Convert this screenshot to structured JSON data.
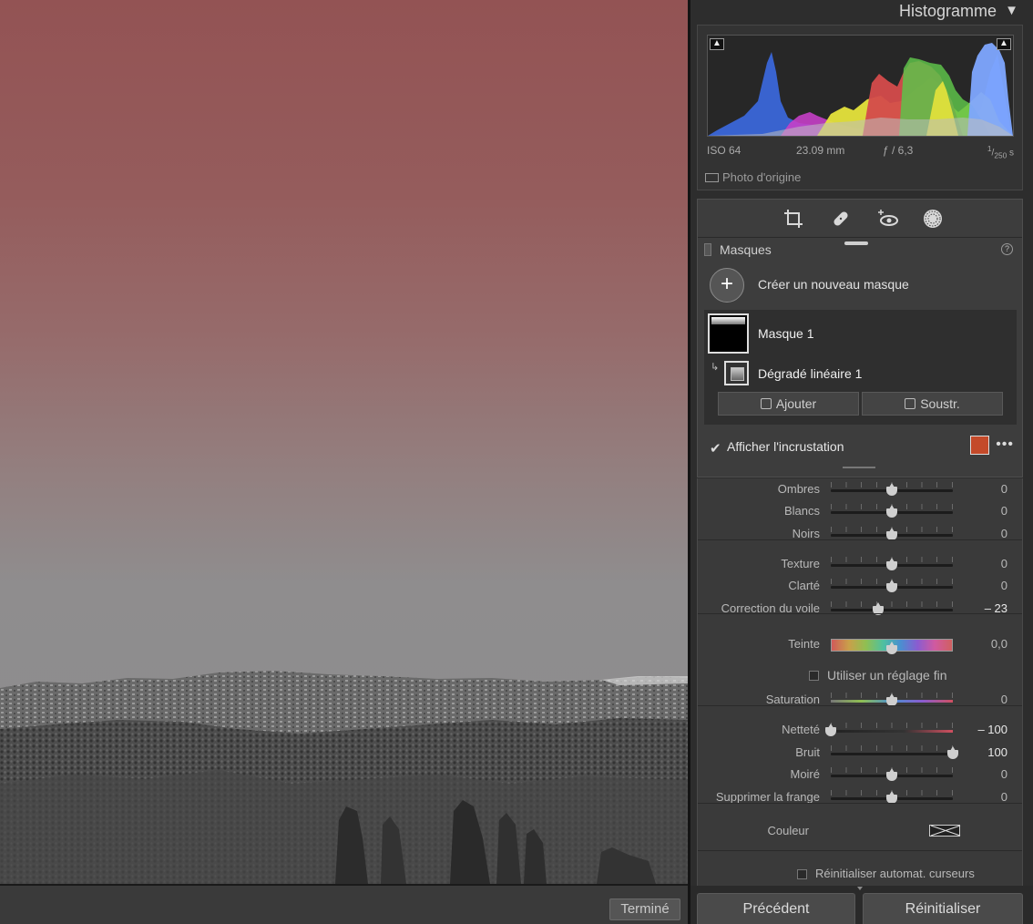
{
  "photo": {
    "done_label": "Terminé"
  },
  "histogram": {
    "title": "Histogramme",
    "iso": "ISO 64",
    "focal": "23.09 mm",
    "aperture": "ƒ / 6,3",
    "shutter_num": "1",
    "shutter_den": "250",
    "shutter_unit": "s",
    "original_label": "Photo d'origine"
  },
  "masks": {
    "header": "Masques",
    "new_mask_label": "Créer un nouveau masque",
    "mask1_label": "Masque 1",
    "gradient_label": "Dégradé linéaire 1",
    "add_label": "Ajouter",
    "subtract_label": "Soustr.",
    "overlay_label": "Afficher l'incrustation",
    "overlay_checked": true,
    "overlay_color": "#c44a2a"
  },
  "sliders": [
    {
      "label": "Ombres",
      "value": "0",
      "pos": 0.5
    },
    {
      "label": "Blancs",
      "value": "0",
      "pos": 0.5
    },
    {
      "label": "Noirs",
      "value": "0",
      "pos": 0.5
    },
    {
      "label": "Texture",
      "value": "0",
      "pos": 0.5
    },
    {
      "label": "Clarté",
      "value": "0",
      "pos": 0.5
    },
    {
      "label": "Correction du voile",
      "value": "– 23",
      "pos": 0.385
    },
    {
      "label": "Teinte",
      "value": "0,0",
      "pos": 0.5
    },
    {
      "label": "Saturation",
      "value": "0",
      "pos": 0.5
    },
    {
      "label": "Netteté",
      "value": "– 100",
      "pos": 0.0
    },
    {
      "label": "Bruit",
      "value": "100",
      "pos": 1.0
    },
    {
      "label": "Moiré",
      "value": "0",
      "pos": 0.5
    },
    {
      "label": "Supprimer la frange",
      "value": "0",
      "pos": 0.5
    }
  ],
  "fine_adjust_label": "Utiliser un réglage fin",
  "color_label": "Couleur",
  "reset_sliders_label": "Réinitialiser automat. curseurs",
  "nav": {
    "previous": "Précédent",
    "reset": "Réinitialiser"
  }
}
